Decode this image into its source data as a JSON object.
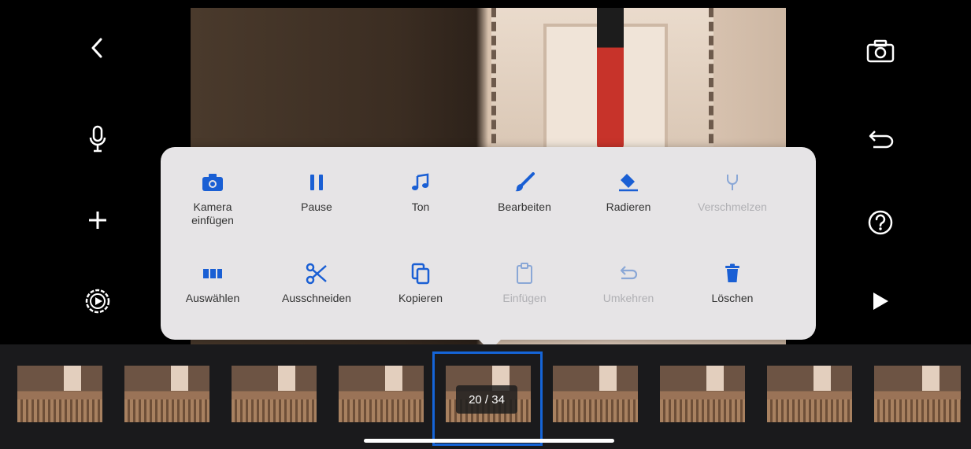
{
  "colors": {
    "accent": "#1a5fd4",
    "disabled": "#b0b0b4",
    "popup_bg": "#e6e4e6",
    "selection": "#1565d8"
  },
  "left_toolbar": [
    {
      "name": "back-icon"
    },
    {
      "name": "microphone-icon"
    },
    {
      "name": "plus-icon"
    },
    {
      "name": "settings-icon"
    }
  ],
  "right_toolbar": [
    {
      "name": "camera-switch-icon"
    },
    {
      "name": "undo-icon"
    },
    {
      "name": "help-icon"
    },
    {
      "name": "play-icon"
    }
  ],
  "menu": {
    "row1": [
      {
        "label": "Kamera\neinfügen",
        "icon": "camera-icon",
        "enabled": true
      },
      {
        "label": "Pause",
        "icon": "pause-icon",
        "enabled": true
      },
      {
        "label": "Ton",
        "icon": "music-note-icon",
        "enabled": true
      },
      {
        "label": "Bearbeiten",
        "icon": "brush-icon",
        "enabled": true
      },
      {
        "label": "Radieren",
        "icon": "eraser-icon",
        "enabled": true
      },
      {
        "label": "Verschmelzen",
        "icon": "merge-icon",
        "enabled": false
      }
    ],
    "row2": [
      {
        "label": "Auswählen",
        "icon": "select-frames-icon",
        "enabled": true
      },
      {
        "label": "Ausschneiden",
        "icon": "scissors-icon",
        "enabled": true
      },
      {
        "label": "Kopieren",
        "icon": "copy-icon",
        "enabled": true
      },
      {
        "label": "Einfügen",
        "icon": "clipboard-icon",
        "enabled": false
      },
      {
        "label": "Umkehren",
        "icon": "reverse-icon",
        "enabled": false
      },
      {
        "label": "Löschen",
        "icon": "trash-icon",
        "enabled": true
      }
    ]
  },
  "filmstrip": {
    "frame_counter": "20 / 34",
    "current_frame": 20,
    "total_frames": 34
  }
}
